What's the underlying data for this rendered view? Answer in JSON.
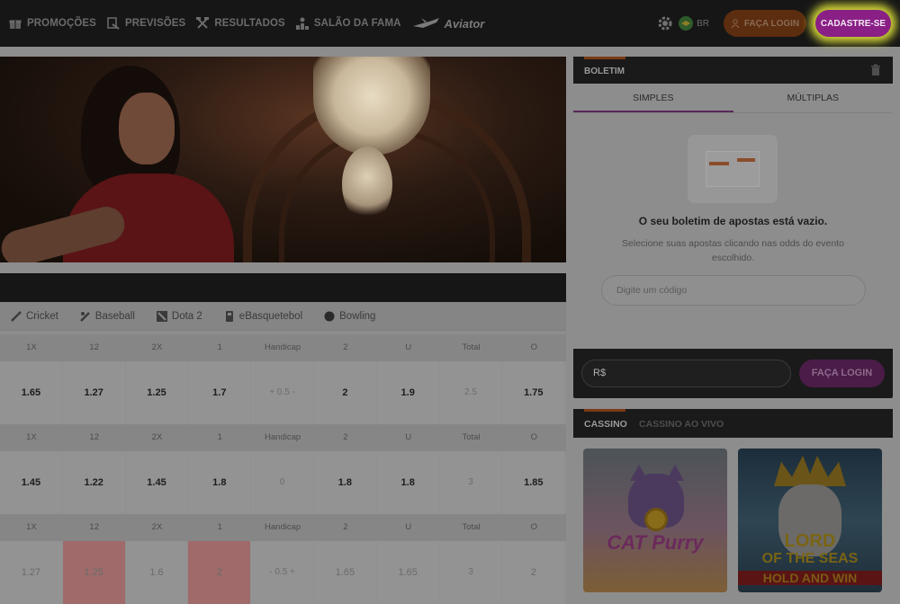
{
  "nav": {
    "items": [
      {
        "label": "PROMOÇÕES",
        "icon": "gift-icon"
      },
      {
        "label": "PREVISÕES",
        "icon": "forecast-icon"
      },
      {
        "label": "RESULTADOS",
        "icon": "hammers-icon"
      },
      {
        "label": "SALÃO DA FAMA",
        "icon": "podium-icon"
      }
    ],
    "aviator": "Aviator"
  },
  "header": {
    "lang": "BR",
    "login": "FAÇA LOGIN",
    "signup": "CADASTRE-SE"
  },
  "sports": {
    "tabs": [
      {
        "label": "Cricket",
        "icon": "cricket-icon"
      },
      {
        "label": "Baseball",
        "icon": "baseball-icon"
      },
      {
        "label": "Dota 2",
        "icon": "dota-icon"
      },
      {
        "label": "eBasquetebol",
        "icon": "ebasket-icon"
      },
      {
        "label": "Bowling",
        "icon": "bowling-icon"
      }
    ],
    "headers": [
      "1X",
      "12",
      "2X",
      "1",
      "Handicap",
      "2",
      "U",
      "Total",
      "O"
    ],
    "rows": [
      [
        "1.65",
        "1.27",
        "1.25",
        "1.7",
        "+ 0.5 -",
        "2",
        "1.9",
        "2.5",
        "1.75"
      ],
      [
        "1.45",
        "1.22",
        "1.45",
        "1.8",
        "0",
        "1.8",
        "1.8",
        "3",
        "1.85"
      ],
      [
        "1.27",
        "1.25",
        "1.6",
        "2",
        "- 0.5 +",
        "1.65",
        "1.65",
        "3",
        "2"
      ]
    ]
  },
  "boletim": {
    "title": "BOLETIM",
    "tabs": [
      "SIMPLES",
      "MÚLTIPLAS"
    ],
    "empty_title": "O seu boletim de apostas está vazio.",
    "empty_sub": "Selecione suas apostas clicando nas odds do evento escolhido.",
    "code_placeholder": "Digite um código",
    "currency": "R$",
    "login": "FAÇA LOGIN"
  },
  "casino": {
    "tabs": [
      "CASSINO",
      "CASSINO AO VIVO"
    ],
    "games": [
      {
        "title": "CAT Purry"
      },
      {
        "title_line1": "LORD",
        "title_line2": "OF THE SEAS",
        "title_line3": "HOLD AND WIN"
      }
    ]
  },
  "colors": {
    "accent": "#8a1f86",
    "login": "#5c2d0e",
    "highlight": "#ebf03c"
  }
}
